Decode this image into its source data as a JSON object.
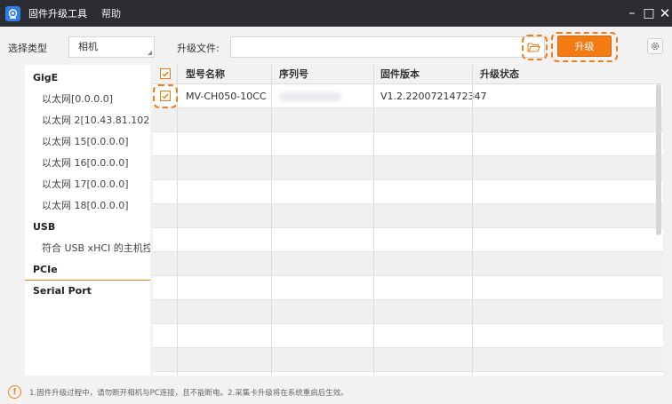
{
  "window": {
    "title": "固件升级工具",
    "menu_help": "帮助",
    "minimize": "–",
    "maximize": "□",
    "close": "✕",
    "logo_icon": "camera-icon"
  },
  "toolbar": {
    "type_label": "选择类型",
    "type_value": "相机",
    "file_label": "升级文件:",
    "file_value": "",
    "folder_icon": "folder-open-icon",
    "upgrade_label": "升级",
    "settings_icon": "gear-icon"
  },
  "sidebar": {
    "groups": [
      {
        "label": "GigE",
        "items": [
          "以太网[0.0.0.0]",
          "以太网 2[10.43.81.102]",
          "以太网 15[0.0.0.0]",
          "以太网 16[0.0.0.0]",
          "以太网 17[0.0.0.0]",
          "以太网 18[0.0.0.0]"
        ]
      },
      {
        "label": "USB",
        "items": [
          "符合 USB xHCI 的主机控..."
        ]
      },
      {
        "label": "PCIe",
        "items": []
      },
      {
        "label": "Serial Port",
        "items": []
      }
    ],
    "selected": "PCIe"
  },
  "table": {
    "columns": [
      "型号名称",
      "序列号",
      "固件版本",
      "升级状态"
    ],
    "rows": [
      {
        "checked": true,
        "model": "MV-CH050-10CC",
        "serial": "",
        "firmware": "V1.2.2200721472347",
        "status": ""
      }
    ],
    "header_checked": true
  },
  "footer": {
    "icon": "warning-icon",
    "text": "1.固件升级过程中，请勿断开相机与PC连接，且不能断电。2.采集卡升级将在系统重启后生效。"
  },
  "colors": {
    "accent": "#f27c13",
    "titlebar": "#2b2d33",
    "logo": "#2f7fe8"
  }
}
